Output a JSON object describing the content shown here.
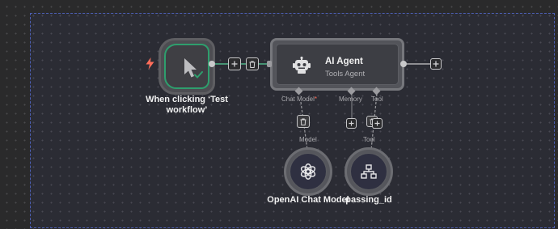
{
  "canvas": {
    "nodes": {
      "trigger": {
        "name": "When clicking ‘Test workflow’",
        "line1": "When clicking ‘Test",
        "line2": "workflow’",
        "status": "success",
        "icon": "mouse-pointer-icon",
        "trigger_icon": "lightning-bolt-icon"
      },
      "agent": {
        "title": "AI Agent",
        "subtitle": "Tools Agent",
        "icon": "robot-icon"
      },
      "chat_model": {
        "name": "OpenAI Chat Model",
        "icon": "openai-icon"
      },
      "tool": {
        "name": "passing_id",
        "icon": "network-icon"
      }
    },
    "connectors": {
      "chat_model": {
        "label": "Chat Model",
        "required_marker": "*"
      },
      "memory": {
        "label": "Memory"
      },
      "tool": {
        "label": "Tool"
      }
    },
    "edge_labels": {
      "model": "Model",
      "tool": "Tool"
    },
    "colors": {
      "success": "#2e9e6d",
      "connection": "#4fb58a",
      "required": "#ff6d5a",
      "selection": "#4c5fb3"
    }
  }
}
